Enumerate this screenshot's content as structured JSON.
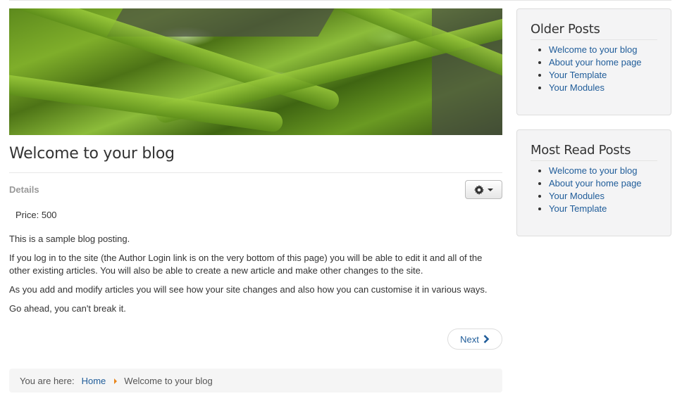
{
  "article": {
    "title": "Welcome to your blog",
    "details_label": "Details",
    "price": "Price: 500",
    "paragraphs": [
      "This is a sample blog posting.",
      "If you log in to the site (the Author Login link is on the very bottom of this page) you will be able to edit it and all of the other existing articles. You will also be able to create a new article and make other changes to the site.",
      "As you add and modify articles you will see how your site changes and also how you can customise it in various ways.",
      "Go ahead, you can't break it."
    ],
    "next_label": "Next"
  },
  "breadcrumb": {
    "label": "You are here:",
    "home": "Home",
    "current": "Welcome to your blog"
  },
  "modules": {
    "older": {
      "title": "Older Posts",
      "items": [
        "Welcome to your blog",
        "About your home page",
        "Your Template",
        "Your Modules"
      ]
    },
    "most_read": {
      "title": "Most Read Posts",
      "items": [
        "Welcome to your blog",
        "About your home page",
        "Your Modules",
        "Your Template"
      ]
    }
  },
  "colors": {
    "link": "#1f5c99",
    "breadcrumb_arrow": "#e8861c"
  }
}
